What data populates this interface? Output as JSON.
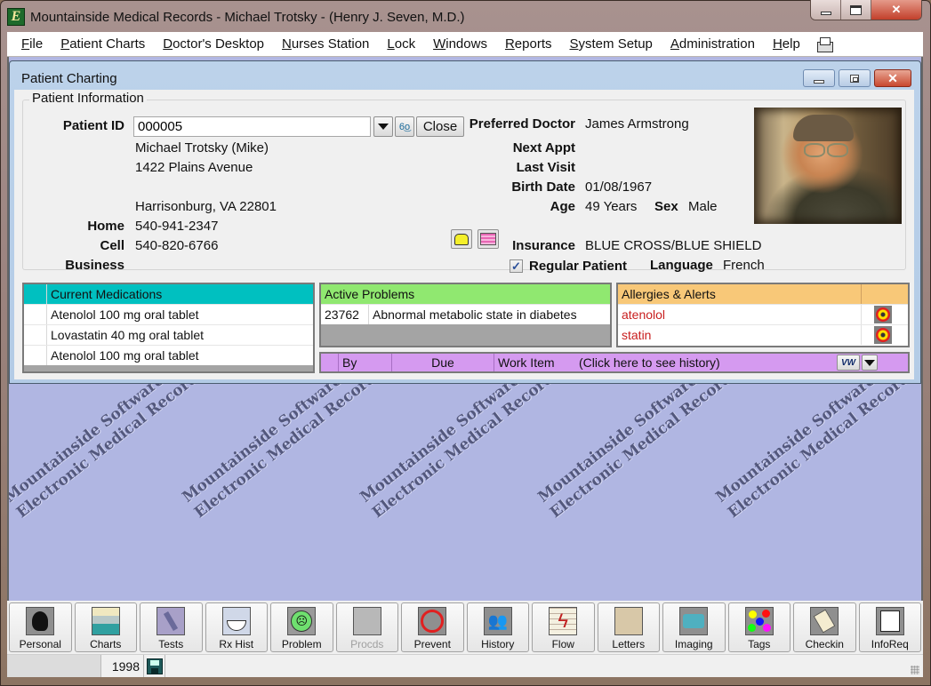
{
  "window": {
    "title": "Mountainside Medical Records - Michael Trotsky - (Henry J. Seven, M.D.)",
    "app_icon_letter": "E",
    "controls": {
      "minimize": "minimize",
      "maximize": "maximize",
      "close": "✕"
    }
  },
  "menu": {
    "items": [
      {
        "label": "File",
        "accel": "F",
        "rest": "ile"
      },
      {
        "label": "Patient Charts",
        "accel": "P",
        "rest": "atient Charts"
      },
      {
        "label": "Doctor's Desktop",
        "accel": "D",
        "rest": "octor's Desktop"
      },
      {
        "label": "Nurses Station",
        "accel": "N",
        "rest": "urses Station"
      },
      {
        "label": "Lock",
        "accel": "L",
        "rest": "ock"
      },
      {
        "label": "Windows",
        "accel": "W",
        "rest": "indows"
      },
      {
        "label": "Reports",
        "accel": "R",
        "rest": "eports"
      },
      {
        "label": "System Setup",
        "accel": "S",
        "rest": "ystem Setup"
      },
      {
        "label": "Administration",
        "accel": "A",
        "rest": "dministration"
      },
      {
        "label": "Help",
        "accel": "H",
        "rest": "elp"
      }
    ],
    "printer_icon": "printer-icon"
  },
  "child_window": {
    "title": "Patient Charting",
    "close_glyph": "✕"
  },
  "patient_info": {
    "group_label": "Patient Information",
    "patient_id_label": "Patient ID",
    "patient_id_value": "000005",
    "close_button": "Close",
    "name": "Michael Trotsky (Mike)",
    "address1": "1422 Plains Avenue",
    "address2": "",
    "city_state_zip": "Harrisonburg, VA  22801",
    "home_label": "Home",
    "home_value": "540-941-2347",
    "cell_label": "Cell",
    "cell_value": "540-820-6766",
    "business_label": "Business",
    "business_value": "",
    "preferred_doctor_label": "Preferred Doctor",
    "preferred_doctor_value": "James Armstrong",
    "next_appt_label": "Next Appt",
    "next_appt_value": "",
    "last_visit_label": "Last Visit",
    "last_visit_value": "",
    "birth_date_label": "Birth Date",
    "birth_date_value": "01/08/1967",
    "age_label": "Age",
    "age_value": "49 Years",
    "sex_label": "Sex",
    "sex_value": "Male",
    "insurance_label": "Insurance",
    "insurance_value": "BLUE CROSS/BLUE SHIELD",
    "regular_patient_label": "Regular Patient",
    "regular_patient_checked": true,
    "checkmark": "✓",
    "language_label": "Language",
    "language_value": "French"
  },
  "medications": {
    "header": "Current Medications",
    "header_color": "#00c0c0",
    "rows": [
      "Atenolol 100 mg oral tablet",
      "Lovastatin 40 mg oral tablet",
      "Atenolol 100 mg oral tablet"
    ]
  },
  "problems": {
    "header": "Active Problems",
    "header_color": "#90e870",
    "rows": [
      {
        "code": "23762",
        "description": "Abnormal metabolic state in diabetes"
      }
    ]
  },
  "allergies": {
    "header": "Allergies & Alerts",
    "header_color": "#f8c878",
    "text_color": "#c81e1e",
    "rows": [
      "atenolol",
      "statin"
    ]
  },
  "work_items": {
    "columns": [
      "By",
      "Due",
      "Work Item",
      "(Click here to see history)"
    ],
    "bar_color": "#d59af0"
  },
  "watermark": {
    "line1": "Mountainside Software",
    "line2": "Electronic Medical Records"
  },
  "toolbar": {
    "buttons": [
      {
        "label": "Personal",
        "icon": "head-icon",
        "disabled": false
      },
      {
        "label": "Charts",
        "icon": "folders-icon",
        "disabled": false
      },
      {
        "label": "Tests",
        "icon": "microscope-icon",
        "disabled": false
      },
      {
        "label": "Rx Hist",
        "icon": "mortar-pestle-icon",
        "disabled": false
      },
      {
        "label": "Problem",
        "icon": "sad-face-icon",
        "disabled": false
      },
      {
        "label": "Procds",
        "icon": "procedure-icon",
        "disabled": true
      },
      {
        "label": "Prevent",
        "icon": "prevent-icon",
        "disabled": false
      },
      {
        "label": "History",
        "icon": "history-people-icon",
        "disabled": false
      },
      {
        "label": "Flow",
        "icon": "flow-chart-icon",
        "disabled": false
      },
      {
        "label": "Letters",
        "icon": "letter-writing-icon",
        "disabled": false
      },
      {
        "label": "Imaging",
        "icon": "camera-icon",
        "disabled": false
      },
      {
        "label": "Tags",
        "icon": "color-tags-icon",
        "disabled": false
      },
      {
        "label": "Checkin",
        "icon": "clipboard-icon",
        "disabled": false
      },
      {
        "label": "InfoReq",
        "icon": "info-request-icon",
        "disabled": false
      }
    ]
  },
  "status_bar": {
    "year": "1998"
  }
}
